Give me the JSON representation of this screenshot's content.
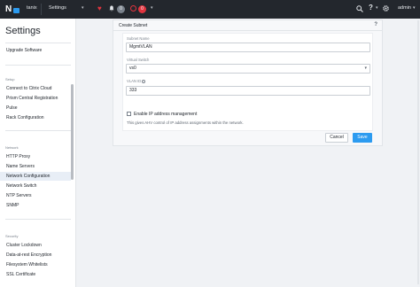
{
  "topbar": {
    "cluster_name": "tanix",
    "nav_title": "Settings",
    "alert_count_1": "0",
    "alert_count_2": "0",
    "user_name": "admin"
  },
  "sidebar": {
    "title": "Settings",
    "top_items": [
      "Upgrade Software"
    ],
    "groups": [
      {
        "label": "Setup",
        "items": [
          "Connect to Citrix Cloud",
          "Prism Central Registration",
          "Pulse",
          "Rack Configuration"
        ]
      },
      {
        "label": "Network",
        "items": [
          "HTTP Proxy",
          "Name Servers",
          "Network Configuration",
          "Network Switch",
          "NTP Servers",
          "SNMP"
        ]
      },
      {
        "label": "Security",
        "items": [
          "Cluster Lockdown",
          "Data-at-rest Encryption",
          "Filesystem Whitelists",
          "SSL Certificate"
        ]
      }
    ],
    "active_item": "Network Configuration"
  },
  "dialog": {
    "title": "Create Subnet",
    "help": "?",
    "subnet_name_label": "Subnet Name",
    "subnet_name_value": "MgmtVLAN",
    "virtual_switch_label": "Virtual Switch",
    "virtual_switch_value": "vs0",
    "vlan_id_label": "VLAN ID",
    "vlan_id_value": "333",
    "ipam_label": "Enable IP address management",
    "ipam_checked": false,
    "ipam_help": "This gives AHV control of IP address assignments within the network.",
    "cancel_label": "Cancel",
    "save_label": "Save"
  },
  "colors": {
    "topbar_bg": "#23272d",
    "accent": "#2c9bf0",
    "alert": "#e1343f"
  }
}
